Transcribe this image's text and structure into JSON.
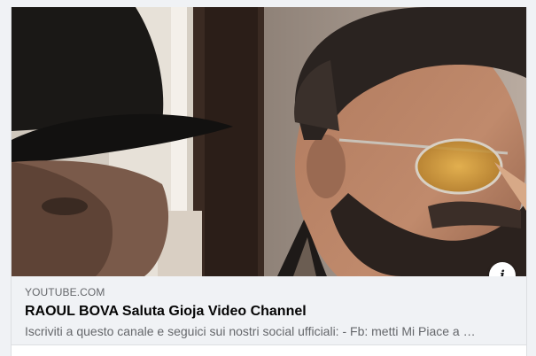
{
  "link_preview": {
    "domain": "YOUTUBE.COM",
    "title": "RAOUL BOVA Saluta Gioja Video Channel",
    "description": "Iscriviti a questo canale e seguici sui nostri social ufficiali: - Fb: metti Mi Piace a …",
    "info_icon": "info-icon",
    "info_glyph": "i"
  },
  "colors": {
    "background": "#f0f2f5",
    "domain_text": "#65676b",
    "title_text": "#050505",
    "description_text": "#65676b"
  }
}
